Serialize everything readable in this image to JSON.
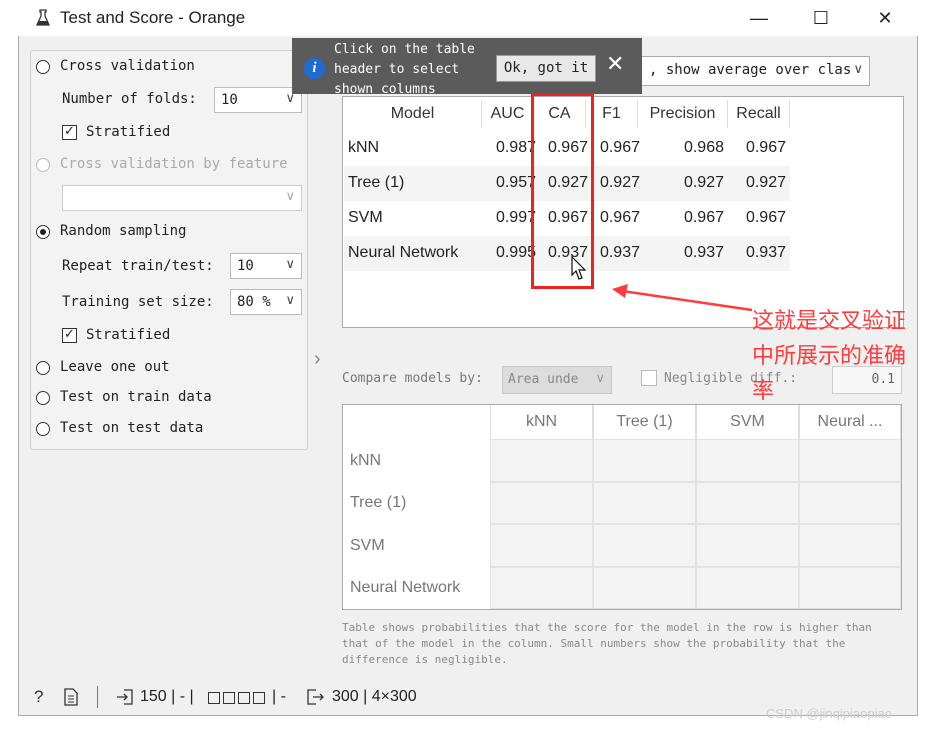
{
  "window": {
    "title": "Test and Score - Orange",
    "app_icon": "orange-flask-icon",
    "minimize": "—",
    "maximize": "☐",
    "close": "✕"
  },
  "sampling": {
    "cross_validation": "Cross validation",
    "folds_label": "Number of folds:",
    "folds_value": "10",
    "stratified": "Stratified",
    "cv_by_feature": "Cross validation by feature",
    "random_sampling": "Random sampling",
    "repeat_label": "Repeat train/test:",
    "repeat_value": "10",
    "train_size_label": "Training set size:",
    "train_size_value": "80 %",
    "stratified2": "Stratified",
    "leave_one_out": "Leave one out",
    "test_on_train": "Test on train data",
    "test_on_test": "Test on test data",
    "selected": "Random sampling"
  },
  "tooltip": {
    "text": "Click on the table\nheader to select\nshown columns",
    "ok": "Ok, got it",
    "close": "✕"
  },
  "target": {
    "value": ", show average over clas"
  },
  "results": {
    "columns": [
      "Model",
      "AUC",
      "CA",
      "F1",
      "Precision",
      "Recall"
    ],
    "rows": [
      {
        "model": "kNN",
        "auc": "0.987",
        "ca": "0.967",
        "f1": "0.967",
        "precision": "0.968",
        "recall": "0.967"
      },
      {
        "model": "Tree (1)",
        "auc": "0.957",
        "ca": "0.927",
        "f1": "0.927",
        "precision": "0.927",
        "recall": "0.927"
      },
      {
        "model": "SVM",
        "auc": "0.997",
        "ca": "0.967",
        "f1": "0.967",
        "precision": "0.967",
        "recall": "0.967"
      },
      {
        "model": "Neural Network",
        "auc": "0.995",
        "ca": "0.937",
        "f1": "0.937",
        "precision": "0.937",
        "recall": "0.937"
      }
    ]
  },
  "compare": {
    "label": "Compare models by:",
    "value": "Area unde",
    "negligible_label": "Negligible diff.:",
    "negligible_value": "0.1",
    "columns": [
      "kNN",
      "Tree (1)",
      "SVM",
      "Neural ..."
    ],
    "rows": [
      "kNN",
      "Tree (1)",
      "SVM",
      "Neural Network"
    ],
    "footnote": "Table shows probabilities that the score for the model in the row is higher than that of the model in the column. Small numbers show the probability that the difference is negligible."
  },
  "statusbar": {
    "help": "?",
    "input_count": "150 | - | ",
    "sep": " | - ",
    "output_count": "300 | 4×300"
  },
  "annotation": {
    "text": "这就是交叉验证中所展示的准确率",
    "color": "#ff3b3b"
  },
  "watermark": "CSDN @jinqipiaopiao"
}
